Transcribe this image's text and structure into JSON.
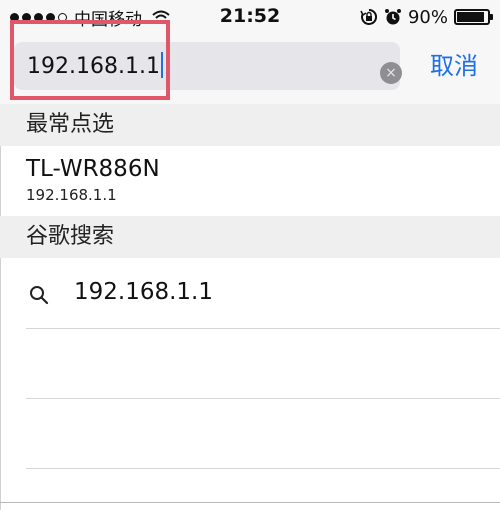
{
  "status_bar": {
    "carrier": "中国移动",
    "time": "21:52",
    "battery": "90%",
    "battery_level": 0.9,
    "icons": [
      "signal-dots",
      "wifi-icon",
      "rotation-lock-icon",
      "alarm-icon",
      "battery-icon"
    ]
  },
  "search": {
    "value": "192.168.1.1",
    "cancel_label": "取消",
    "clear_icon": "×"
  },
  "sections": {
    "frequent": {
      "header": "最常点选",
      "items": [
        {
          "title": "TL-WR886N",
          "subtitle": "192.168.1.1"
        }
      ]
    },
    "google": {
      "header": "谷歌搜索",
      "items": [
        {
          "query": "192.168.1.1"
        }
      ]
    }
  },
  "colors": {
    "accent": "#1f6fe8",
    "highlight": "#e0576a"
  }
}
